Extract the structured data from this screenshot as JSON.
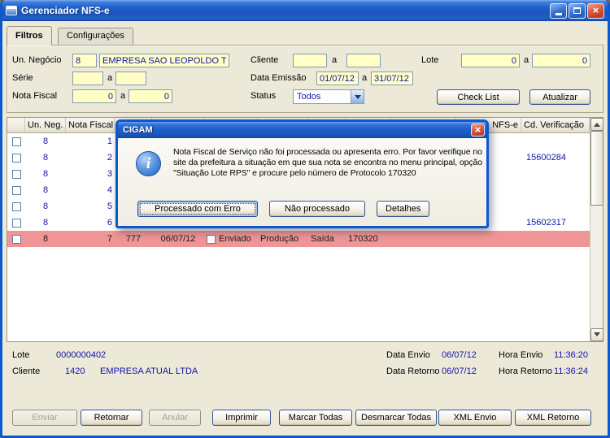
{
  "window": {
    "title": "Gerenciador NFS-e"
  },
  "icons": {
    "close": "×",
    "info": "i"
  },
  "colors": {
    "titlebar_blue": "#1C5CC6",
    "window_frame": "#0C59CF",
    "panel_bg": "#ECE9D8",
    "field_yellow": "#FFFFC6",
    "value_blue": "#1414AA",
    "highlight_row": "#EF9595"
  },
  "tabs": {
    "filtros": "Filtros",
    "configuracoes": "Configurações"
  },
  "filters": {
    "un_negocio_label": "Un. Negócio",
    "un_negocio_code": "8",
    "un_negocio_name": "EMPRESA SAO LEOPOLDO TESTE",
    "cliente_label": "Cliente",
    "cliente_from": "",
    "cliente_to": "",
    "lote_label": "Lote",
    "lote_from": "0",
    "lote_to": "0",
    "serie_label": "Série",
    "serie_from": "",
    "serie_to": "",
    "data_emissao_label": "Data Emissão",
    "data_emissao_from": "01/07/12",
    "data_emissao_to": "31/07/12",
    "nota_fiscal_label": "Nota Fiscal",
    "nota_fiscal_from": "0",
    "nota_fiscal_to": "0",
    "status_label": "Status",
    "status_value": "Todos",
    "range_separator": "a",
    "check_list_button": "Check List",
    "atualizar_button": "Atualizar"
  },
  "grid": {
    "headers": {
      "un_neg": "Un. Neg.",
      "nota_fiscal": "Nota Fiscal",
      "nfse": "NFS-e",
      "cd_verificacao": "Cd. Verificação"
    },
    "rows": [
      {
        "un_neg": "8",
        "nota_fiscal": "1",
        "serie": "",
        "dt_emissao": "",
        "enviado": "",
        "ambiente": "",
        "tipo": "",
        "protocolo": "",
        "nfse": "",
        "cd_verificacao": ""
      },
      {
        "un_neg": "8",
        "nota_fiscal": "2",
        "serie": "",
        "dt_emissao": "",
        "enviado": "",
        "ambiente": "",
        "tipo": "",
        "protocolo": "",
        "nfse": "",
        "cd_verificacao": "15600284"
      },
      {
        "un_neg": "8",
        "nota_fiscal": "3",
        "serie": "",
        "dt_emissao": "",
        "enviado": "",
        "ambiente": "",
        "tipo": "",
        "protocolo": "",
        "nfse": "",
        "cd_verificacao": ""
      },
      {
        "un_neg": "8",
        "nota_fiscal": "4",
        "serie": "",
        "dt_emissao": "",
        "enviado": "",
        "ambiente": "",
        "tipo": "",
        "protocolo": "",
        "nfse": "",
        "cd_verificacao": ""
      },
      {
        "un_neg": "8",
        "nota_fiscal": "5",
        "serie": "",
        "dt_emissao": "",
        "enviado": "",
        "ambiente": "",
        "tipo": "",
        "protocolo": "",
        "nfse": "",
        "cd_verificacao": ""
      },
      {
        "un_neg": "8",
        "nota_fiscal": "6",
        "serie": "",
        "dt_emissao": "",
        "enviado": "",
        "ambiente": "",
        "tipo": "",
        "protocolo": "",
        "nfse": "",
        "cd_verificacao": "15602317"
      },
      {
        "un_neg": "8",
        "nota_fiscal": "7",
        "serie": "777",
        "dt_emissao": "06/07/12",
        "enviado": "Enviado",
        "ambiente": "Produção",
        "tipo": "Saída",
        "protocolo": "170320",
        "nfse": "",
        "cd_verificacao": ""
      }
    ]
  },
  "dialog": {
    "title": "CIGAM",
    "message": "Nota Fiscal de Serviço não foi processada ou apresenta erro. Por favor verifique no site da prefeitura a situação em que sua nota se encontra no menu principal, opção \"Situação Lote RPS\" e procure pelo número de Protocolo 170320",
    "buttons": {
      "processado_com_erro": "Processado com Erro",
      "nao_processado": "Não processado",
      "detalhes": "Detalhes"
    }
  },
  "summary": {
    "lote_label": "Lote",
    "lote_value": "0000000402",
    "cliente_label": "Cliente",
    "cliente_code": "1420",
    "cliente_name": "EMPRESA ATUAL LTDA",
    "data_envio_label": "Data Envio",
    "data_envio_value": "06/07/12",
    "hora_envio_label": "Hora Envio",
    "hora_envio_value": "11:36:20",
    "data_retorno_label": "Data Retorno",
    "data_retorno_value": "06/07/12",
    "hora_retorno_label": "Hora Retorno",
    "hora_retorno_value": "11:36:24"
  },
  "actions": {
    "enviar": "Enviar",
    "retornar": "Retornar",
    "anular": "Anular",
    "imprimir": "Imprimir",
    "marcar_todas": "Marcar Todas",
    "desmarcar_todas": "Desmarcar Todas",
    "xml_envio": "XML Envio",
    "xml_retorno": "XML Retorno"
  }
}
